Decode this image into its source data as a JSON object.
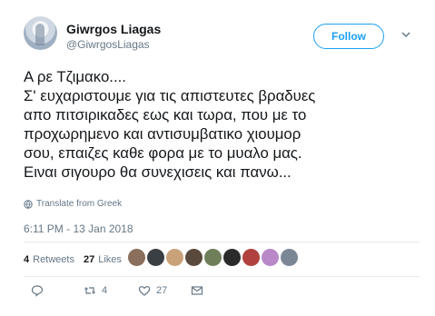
{
  "user": {
    "name": "Giwrgos Liagas",
    "handle": "@GiwrgosLiagas"
  },
  "header": {
    "follow_label": "Follow"
  },
  "tweet": {
    "text": "Α ρε Τζιμακο....\nΣ' ευχαριστουμε για τις απιστευτες βραδυες\nαπο πιτσιρικαδες εως και τωρα, που με το\nπροχωρημενο και αντισυμβατικο χιουμορ\nσου, επαιζες καθε φορα με το μυαλο μας.\nΕιναι σιγουρο θα συνεχισεις και πανω...",
    "translate_label": "Translate from Greek",
    "timestamp": "6:11 PM - 13 Jan 2018"
  },
  "stats": {
    "retweets_count": "4",
    "retweets_label": "Retweets",
    "likes_count": "27",
    "likes_label": "Likes"
  },
  "likers": [
    {
      "color": "#8a6f5c"
    },
    {
      "color": "#3a3f44"
    },
    {
      "color": "#c9a27a"
    },
    {
      "color": "#5a4a3e"
    },
    {
      "color": "#6f7f5a"
    },
    {
      "color": "#2b2b2b"
    },
    {
      "color": "#b0413e"
    },
    {
      "color": "#b888c8"
    },
    {
      "color": "#7b8794"
    }
  ],
  "actions": {
    "reply_count": "",
    "retweet_count": "4",
    "like_count": "27"
  },
  "colors": {
    "accent": "#1da1f2",
    "muted": "#657786",
    "text": "#14171a",
    "divider": "#e6ecf0"
  }
}
